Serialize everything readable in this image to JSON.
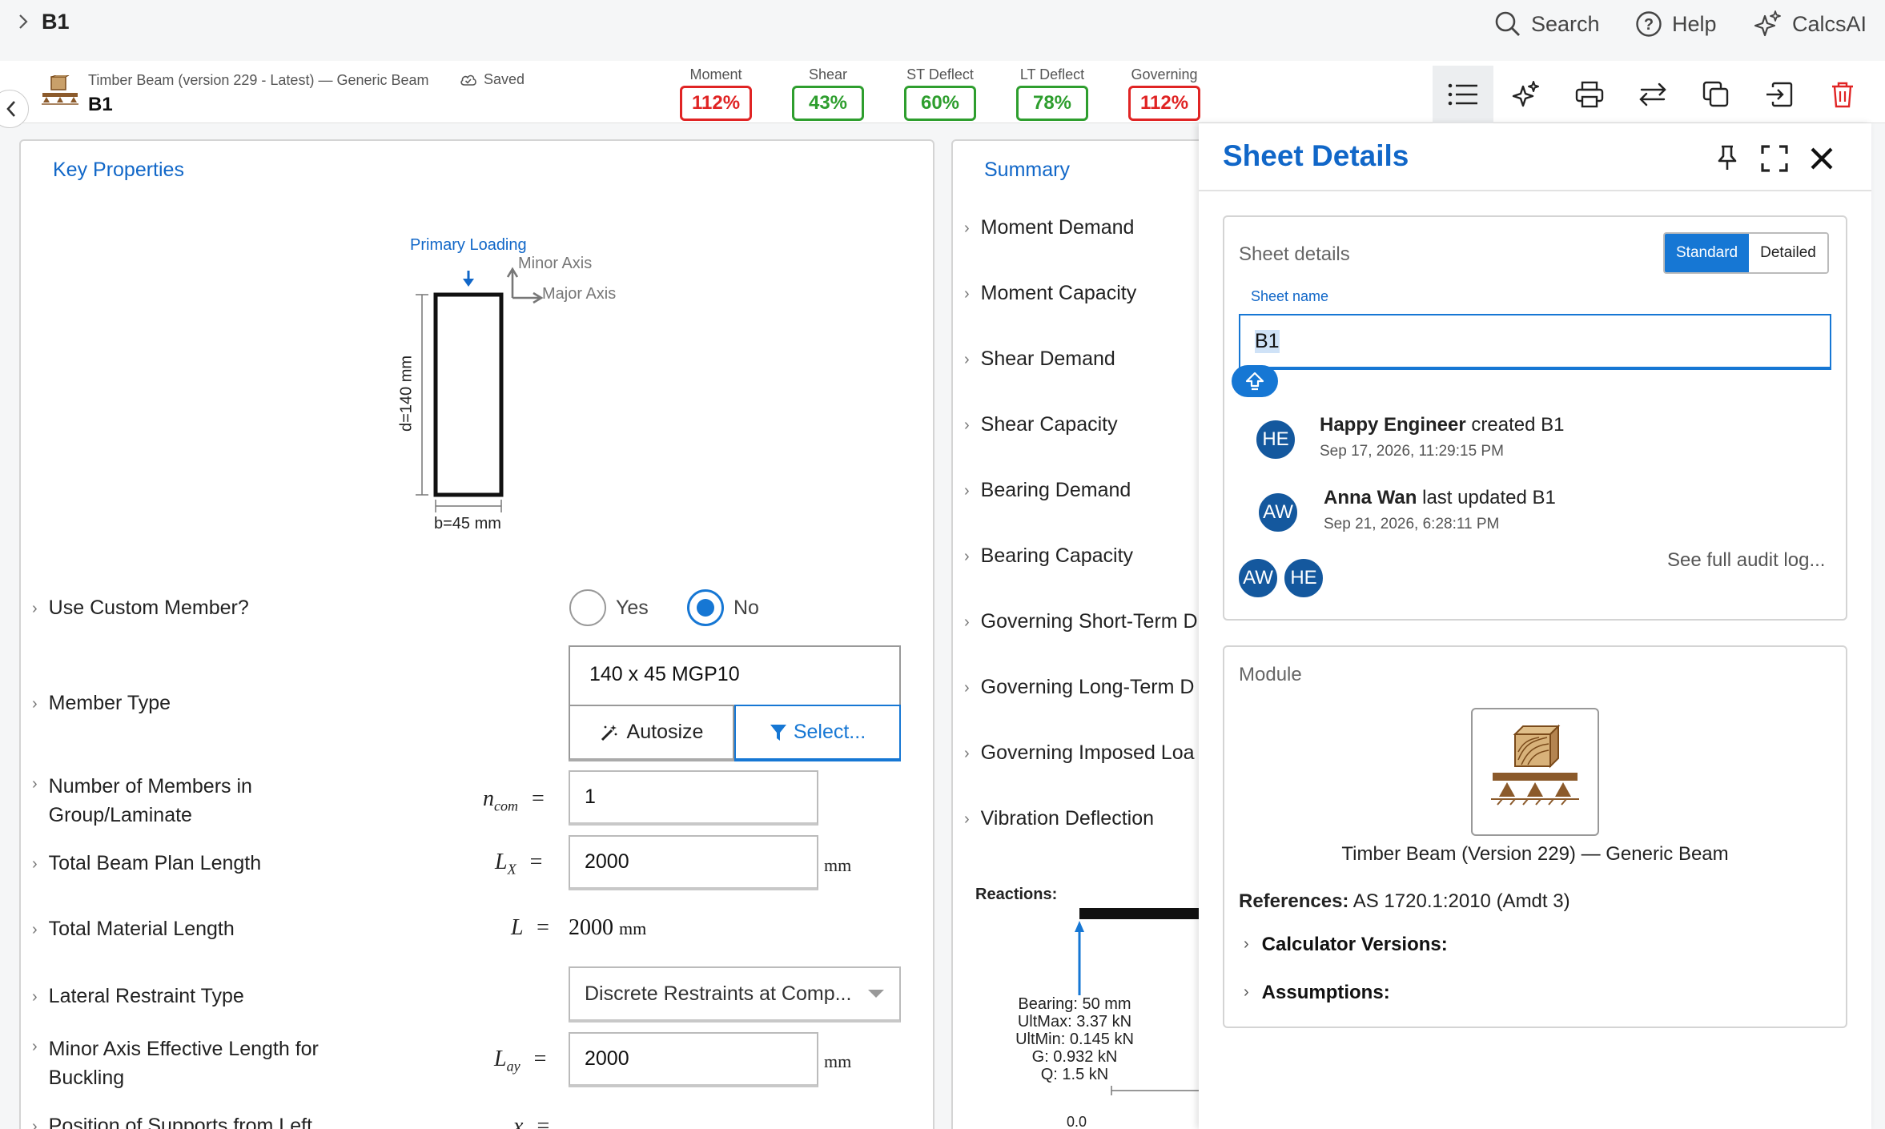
{
  "topbar": {
    "breadcrumb_title": "B1",
    "search_label": "Search",
    "help_label": "Help",
    "ai_label": "CalcsAI"
  },
  "header": {
    "calc_subtitle": "Timber Beam (version 229 - Latest) — Generic Beam",
    "calc_name": "B1",
    "saved_label": "Saved",
    "metrics": [
      {
        "label": "Moment",
        "value": "112%",
        "status": "fail",
        "color": "#e02424"
      },
      {
        "label": "Shear",
        "value": "43%",
        "status": "pass",
        "color": "#2e9e2e"
      },
      {
        "label": "ST Deflect",
        "value": "60%",
        "status": "pass",
        "color": "#2e9e2e"
      },
      {
        "label": "LT Deflect",
        "value": "78%",
        "status": "pass",
        "color": "#2e9e2e"
      },
      {
        "label": "Governing",
        "value": "112%",
        "status": "fail",
        "color": "#e02424"
      }
    ],
    "tools": [
      "list-icon",
      "sparkles-icon",
      "print-icon",
      "swap-icon",
      "copy-icon",
      "import-icon",
      "trash-icon"
    ]
  },
  "key_properties": {
    "title": "Key Properties",
    "diagram": {
      "primary_loading": "Primary Loading",
      "minor_axis": "Minor Axis",
      "major_axis": "Major Axis",
      "depth_label": "d=140 mm",
      "width_label": "b=45 mm"
    },
    "use_custom_member": {
      "label": "Use Custom Member?",
      "yes": "Yes",
      "no": "No",
      "selected": "No"
    },
    "member_type": {
      "label": "Member Type",
      "value": "140 x 45 MGP10",
      "autosize": "Autosize",
      "select": "Select..."
    },
    "num_members": {
      "label_line1": "Number of Members in",
      "label_line2": "Group/Laminate",
      "symbol": "n",
      "subscript": "com",
      "value": "1"
    },
    "plan_length": {
      "label": "Total Beam Plan Length",
      "symbol": "L",
      "subscript": "X",
      "value": "2000",
      "unit": "mm"
    },
    "material_length": {
      "label": "Total Material Length",
      "symbol": "L",
      "value": "2000",
      "unit": "mm"
    },
    "lateral_restraint": {
      "label": "Lateral Restraint Type",
      "value": "Discrete Restraints at Comp..."
    },
    "minor_eff_length": {
      "label_line1": "Minor Axis Effective Length for",
      "label_line2": "Buckling",
      "symbol": "L",
      "subscript": "ay",
      "value": "2000",
      "unit": "mm"
    },
    "supports_position": {
      "label": "Position of Supports from Left",
      "symbol": "x"
    },
    "equals": "="
  },
  "summary": {
    "title": "Summary",
    "items": [
      "Moment Demand",
      "Moment Capacity",
      "Shear Demand",
      "Shear Capacity",
      "Bearing Demand",
      "Bearing Capacity",
      "Governing Short-Term D",
      "Governing Long-Term D",
      "Governing Imposed Loa",
      "Vibration Deflection"
    ],
    "reactions": {
      "title": "Reactions:",
      "lines": [
        "Bearing: 50 mm",
        "UltMax: 3.37 kN",
        "UltMin: 0.145 kN",
        "G: 0.932 kN",
        "Q: 1.5 kN"
      ],
      "axis_tick": "0.0"
    }
  },
  "drawer": {
    "title": "Sheet Details",
    "sheet_details": {
      "heading": "Sheet details",
      "mode_standard": "Standard",
      "mode_detailed": "Detailed",
      "name_label": "Sheet name",
      "name_value": "B1"
    },
    "activity": [
      {
        "initials": "HE",
        "user": "Happy Engineer",
        "action": "created B1",
        "time": "Sep 17, 2026, 11:29:15 PM"
      },
      {
        "initials": "AW",
        "user": "Anna Wan",
        "action": "last updated B1",
        "time": "Sep 21, 2026, 6:28:11 PM"
      }
    ],
    "audit_link": "See full audit log...",
    "collaborators": [
      "AW",
      "HE"
    ],
    "module": {
      "heading": "Module",
      "name": "Timber Beam (Version 229) — Generic Beam",
      "references_label": "References:",
      "references_value": "AS 1720.1:2010 (Amdt 3)",
      "calc_versions": "Calculator Versions:",
      "assumptions": "Assumptions:"
    }
  },
  "colors": {
    "accent": "#1167c8",
    "fail": "#e02424",
    "pass": "#2e9e2e",
    "avatar": "#14589e",
    "timber": "#8b5a2b"
  }
}
